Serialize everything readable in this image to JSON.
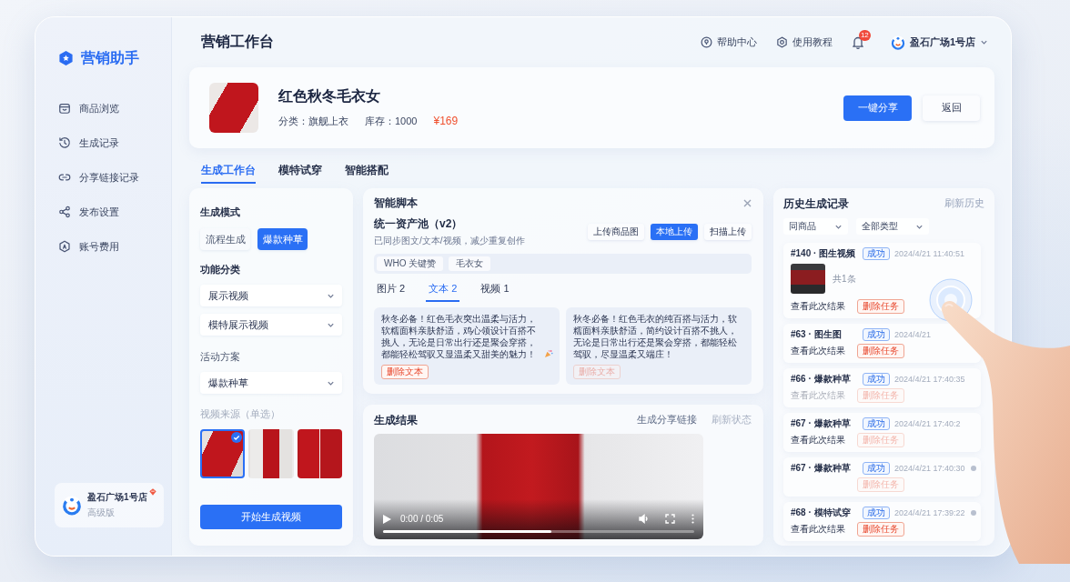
{
  "sidebar": {
    "logo": "营销助手",
    "items": [
      "商品浏览",
      "生成记录",
      "分享链接记录",
      "发布设置",
      "账号费用"
    ],
    "account": {
      "name": "盈石广场1号店",
      "plan": "高级版"
    }
  },
  "header": {
    "title": "营销工作台",
    "links": [
      "帮助中心",
      "使用教程"
    ],
    "notifications": "12",
    "user": "盈石广场1号店"
  },
  "product": {
    "name": "红色秋冬毛衣女",
    "category": "分类：旗舰上衣",
    "stock": "库存：1000",
    "price": "¥169",
    "buttons": [
      {
        "label": "一键分享",
        "kind": "primary"
      },
      {
        "label": "返回",
        "kind": "default"
      }
    ]
  },
  "tabs": [
    {
      "label": "生成工作台",
      "selected": true
    },
    {
      "label": "模特试穿",
      "selected": false
    },
    {
      "label": "智能搭配",
      "selected": false
    }
  ],
  "generator": {
    "mode_label": "生成模式",
    "modes": [
      {
        "label": "流程生成",
        "selected": false
      },
      {
        "label": "爆款种草",
        "selected": true
      }
    ],
    "category_label": "功能分类",
    "category_selects": [
      "展示视频",
      "模特展示视频"
    ],
    "campaign_label": "活动方案",
    "campaign_select": "爆款种草",
    "source_label": "视频来源（单选）",
    "sources": [
      {
        "selected": true
      },
      {
        "selected": false
      },
      {
        "selected": false
      }
    ],
    "submit": "开始生成视频"
  },
  "script": {
    "title": "智能脚本",
    "pool_title": "统一资产池（v2）",
    "pool_subtitle": "已同步图文/文本/视频，减少重复创作",
    "uploads": [
      {
        "label": "上传商品图",
        "kind": "default"
      },
      {
        "label": "本地上传",
        "kind": "primary"
      },
      {
        "label": "扫描上传",
        "kind": "default"
      }
    ],
    "keywords": [
      "WHO 关键赞",
      "毛衣女"
    ],
    "tabs": [
      {
        "label": "图片 2",
        "selected": false
      },
      {
        "label": "文本 2",
        "selected": true
      },
      {
        "label": "视频 1",
        "selected": false
      }
    ],
    "texts": [
      {
        "body": "秋冬必备！红色毛衣突出温柔与活力，软糯面料亲肤舒适，鸡心领设计百搭不挑人，无论是日常出行还是聚会穿搭，都能轻松驾驭又显温柔又甜美的魅力！",
        "emoji": true,
        "action": "删除文本",
        "dimmed": false
      },
      {
        "body": "秋冬必备！红色毛衣的纯百搭与活力，软糯面料亲肤舒适，简约设计百搭不挑人，无论是日常出行还是聚会穿搭，都能轻松驾驭，尽显温柔又端庄！",
        "emoji": false,
        "action": "删除文本",
        "dimmed": true
      }
    ]
  },
  "result": {
    "title": "生成结果",
    "links": [
      {
        "label": "生成分享链接",
        "dimmed": false
      },
      {
        "label": "刷新状态",
        "dimmed": true
      }
    ],
    "video": {
      "time": "0:00 / 0:05",
      "level": 0.54
    }
  },
  "history": {
    "title": "历史生成记录",
    "refresh": "刷新历史",
    "filters": [
      "同商品",
      "全部类型"
    ],
    "records": [
      {
        "title": "#140 · 图生视频",
        "status": "成功",
        "time": "2024/4/21 11:40:51",
        "count": "共1条",
        "flag": false,
        "actions": [
          {
            "label": "查看此次结果",
            "kind": "link",
            "dimmed": false
          },
          {
            "label": "删除任务",
            "kind": "danger",
            "dimmed": false
          }
        ]
      },
      {
        "title": "#63 · 图生图",
        "status": "成功",
        "time": "2024/4/21",
        "flag": false,
        "actions": [
          {
            "label": "查看此次结果",
            "kind": "link",
            "dimmed": false
          },
          {
            "label": "删除任务",
            "kind": "danger",
            "dimmed": false
          }
        ]
      },
      {
        "title": "#66 · 爆款种草",
        "status": "成功",
        "time": "2024/4/21 17:40:35",
        "flag": false,
        "actions": [
          {
            "label": "查看此次结果",
            "kind": "link",
            "dimmed": true
          },
          {
            "label": "删除任务",
            "kind": "danger",
            "dimmed": true
          }
        ]
      },
      {
        "title": "#67 · 爆款种草",
        "status": "成功",
        "time": "2024/4/21 17:40:2",
        "flag": false,
        "actions": [
          {
            "label": "查看此次结果",
            "kind": "link",
            "dimmed": false
          },
          {
            "label": "删除任务",
            "kind": "danger",
            "dimmed": true
          }
        ]
      },
      {
        "title": "#67 · 爆款种草",
        "status": "成功",
        "time": "2024/4/21 17:40:30",
        "flag": true,
        "actions": [
          {
            "label": "删除任务",
            "kind": "danger",
            "dimmed": true
          }
        ]
      },
      {
        "title": "#68 · 模特试穿",
        "status": "成功",
        "time": "2024/4/21 17:39:22",
        "flag": true,
        "actions": [
          {
            "label": "查看此次结果",
            "kind": "link",
            "dimmed": false
          },
          {
            "label": "删除任务",
            "kind": "danger",
            "dimmed": false
          }
        ]
      }
    ]
  }
}
